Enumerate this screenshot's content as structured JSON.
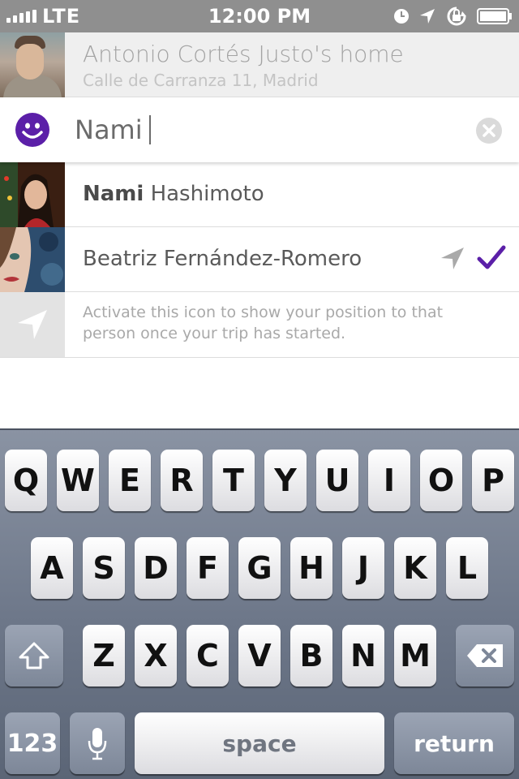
{
  "status_bar": {
    "carrier": "LTE",
    "time": "12:00 PM"
  },
  "destination": {
    "name": "Antonio Cortés Justo's home",
    "address": "Calle de Carranza 11, Madrid"
  },
  "search": {
    "value": "Nami",
    "placeholder": ""
  },
  "results": [
    {
      "name_bold": "Nami",
      "name_rest": " Hashimoto"
    },
    {
      "name_bold": "",
      "name_rest": "Beatriz Fernández-Romero"
    }
  ],
  "hint": {
    "text": "Activate this icon to show your position to that person once your trip has started."
  },
  "keyboard": {
    "row1": [
      "Q",
      "W",
      "E",
      "R",
      "T",
      "Y",
      "U",
      "I",
      "O",
      "P"
    ],
    "row2": [
      "A",
      "S",
      "D",
      "F",
      "G",
      "H",
      "J",
      "K",
      "L"
    ],
    "row3": [
      "Z",
      "X",
      "C",
      "V",
      "B",
      "N",
      "M"
    ],
    "numbers_label": "123",
    "space_label": "space",
    "return_label": "return"
  },
  "colors": {
    "accent": "#5b1fa8",
    "status_bar": "#8f8f8f"
  }
}
